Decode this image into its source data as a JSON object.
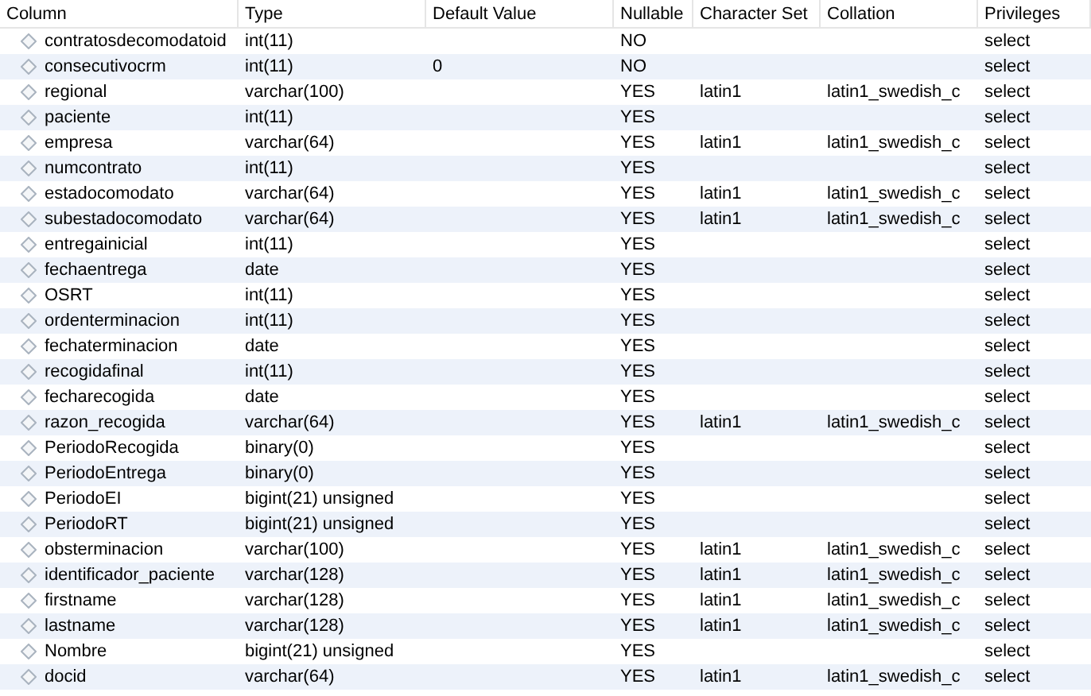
{
  "table": {
    "columns": [
      "Column",
      "Type",
      "Default Value",
      "Nullable",
      "Character Set",
      "Collation",
      "Privileges"
    ],
    "rows": [
      {
        "name": "contratosdecomodatoid",
        "type": "int(11)",
        "nullable": "NO",
        "privileges": "select"
      },
      {
        "name": "consecutivocrm",
        "type": "int(11)",
        "default": "0",
        "nullable": "NO",
        "privileges": "select"
      },
      {
        "name": "regional",
        "type": "varchar(100)",
        "nullable": "YES",
        "charset": "latin1",
        "collation": "latin1_swedish_c",
        "privileges": "select"
      },
      {
        "name": "paciente",
        "type": "int(11)",
        "nullable": "YES",
        "privileges": "select"
      },
      {
        "name": "empresa",
        "type": "varchar(64)",
        "nullable": "YES",
        "charset": "latin1",
        "collation": "latin1_swedish_c",
        "privileges": "select"
      },
      {
        "name": "numcontrato",
        "type": "int(11)",
        "nullable": "YES",
        "privileges": "select"
      },
      {
        "name": "estadocomodato",
        "type": "varchar(64)",
        "nullable": "YES",
        "charset": "latin1",
        "collation": "latin1_swedish_c",
        "privileges": "select"
      },
      {
        "name": "subestadocomodato",
        "type": "varchar(64)",
        "nullable": "YES",
        "charset": "latin1",
        "collation": "latin1_swedish_c",
        "privileges": "select"
      },
      {
        "name": "entregainicial",
        "type": "int(11)",
        "nullable": "YES",
        "privileges": "select"
      },
      {
        "name": "fechaentrega",
        "type": "date",
        "nullable": "YES",
        "privileges": "select"
      },
      {
        "name": "OSRT",
        "type": "int(11)",
        "nullable": "YES",
        "privileges": "select"
      },
      {
        "name": "ordenterminacion",
        "type": "int(11)",
        "nullable": "YES",
        "privileges": "select"
      },
      {
        "name": "fechaterminacion",
        "type": "date",
        "nullable": "YES",
        "privileges": "select"
      },
      {
        "name": "recogidafinal",
        "type": "int(11)",
        "nullable": "YES",
        "privileges": "select"
      },
      {
        "name": "fecharecogida",
        "type": "date",
        "nullable": "YES",
        "privileges": "select"
      },
      {
        "name": "razon_recogida",
        "type": "varchar(64)",
        "nullable": "YES",
        "charset": "latin1",
        "collation": "latin1_swedish_c",
        "privileges": "select"
      },
      {
        "name": "PeriodoRecogida",
        "type": "binary(0)",
        "nullable": "YES",
        "privileges": "select"
      },
      {
        "name": "PeriodoEntrega",
        "type": "binary(0)",
        "nullable": "YES",
        "privileges": "select"
      },
      {
        "name": "PeriodoEI",
        "type": "bigint(21) unsigned",
        "nullable": "YES",
        "privileges": "select"
      },
      {
        "name": "PeriodoRT",
        "type": "bigint(21) unsigned",
        "nullable": "YES",
        "privileges": "select"
      },
      {
        "name": "obsterminacion",
        "type": "varchar(100)",
        "nullable": "YES",
        "charset": "latin1",
        "collation": "latin1_swedish_c",
        "privileges": "select"
      },
      {
        "name": "identificador_paciente",
        "type": "varchar(128)",
        "nullable": "YES",
        "charset": "latin1",
        "collation": "latin1_swedish_c",
        "privileges": "select"
      },
      {
        "name": "firstname",
        "type": "varchar(128)",
        "nullable": "YES",
        "charset": "latin1",
        "collation": "latin1_swedish_c",
        "privileges": "select"
      },
      {
        "name": "lastname",
        "type": "varchar(128)",
        "nullable": "YES",
        "charset": "latin1",
        "collation": "latin1_swedish_c",
        "privileges": "select"
      },
      {
        "name": "Nombre",
        "type": "bigint(21) unsigned",
        "nullable": "YES",
        "privileges": "select"
      },
      {
        "name": "docid",
        "type": "varchar(64)",
        "nullable": "YES",
        "charset": "latin1",
        "collation": "latin1_swedish_c",
        "privileges": "select"
      }
    ]
  }
}
